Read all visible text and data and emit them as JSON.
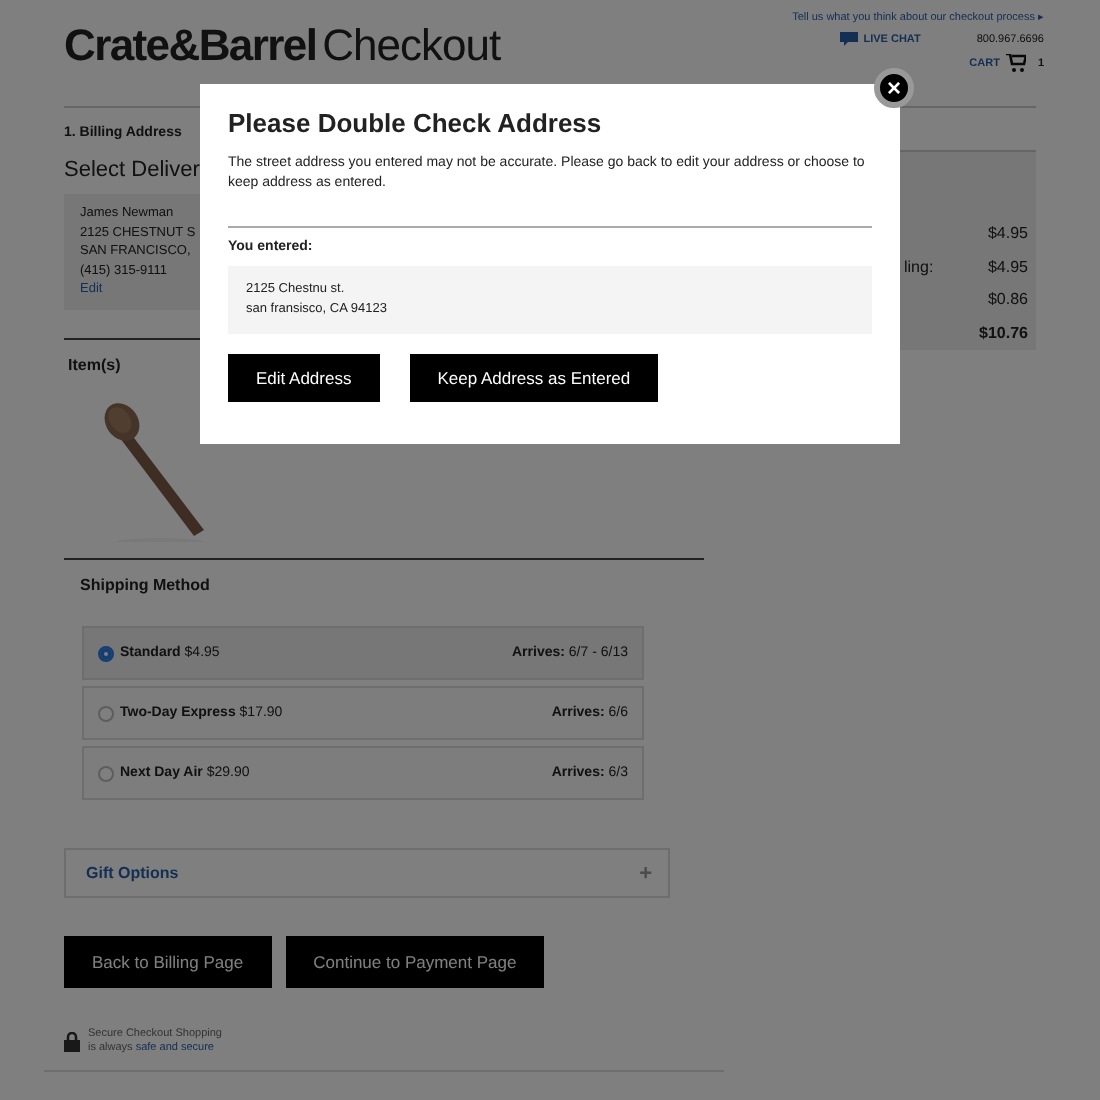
{
  "header": {
    "logo_brand": "Crate&Barrel",
    "logo_suffix": "Checkout",
    "feedback_link": "Tell us what you think about our checkout process ▸",
    "live_chat": "LIVE CHAT",
    "phone": "800.967.6696",
    "cart_label": "CART",
    "cart_count": "1"
  },
  "billing": {
    "step": "1. Billing Address",
    "heading": "Select Deliver",
    "address_lines": [
      "James Newman",
      "2125 CHESTNUT S",
      "SAN FRANCISCO,",
      "(415) 315-9111"
    ],
    "edit_link": "Edit"
  },
  "items": {
    "heading": "Item(s)"
  },
  "shipping": {
    "heading": "Shipping Method",
    "options": [
      {
        "label": "**Standard** $4.95",
        "arrives": "**Arrives:** 6/7 - 6/13",
        "selected": true
      },
      {
        "label": "**Two-Day Express** $17.90",
        "arrives": "**Arrives:** 6/6",
        "selected": false
      },
      {
        "label": "**Next Day Air** $29.90",
        "arrives": "**Arrives:** 6/3",
        "selected": false
      }
    ]
  },
  "gift_options": {
    "label": "Gift Options",
    "expand": "+"
  },
  "buttons": [
    "Back to Billing Page",
    "Continue to Payment Page"
  ],
  "secure": {
    "line1": "Secure Checkout Shopping",
    "line2": "is always",
    "link": "safe and secure"
  },
  "summary": {
    "rows": [
      {
        "amount": "$4.95",
        "total": false
      },
      {
        "label": "ling:",
        "amount": "$4.95",
        "total": false
      },
      {
        "amount": "$0.86",
        "total": false
      },
      {
        "amount": "$10.76",
        "total": true
      }
    ]
  },
  "modal": {
    "close": "×",
    "title": "Please Double Check Address",
    "message": "The street address you entered may not be accurate. Please go back to edit your address or choose to keep address as entered.",
    "entered_label": "You entered:",
    "entered_lines": [
      "2125 Chestnu st.",
      "san fransisco, CA 94123"
    ],
    "buttons": [
      "Edit Address",
      "Keep Address as Entered"
    ]
  }
}
